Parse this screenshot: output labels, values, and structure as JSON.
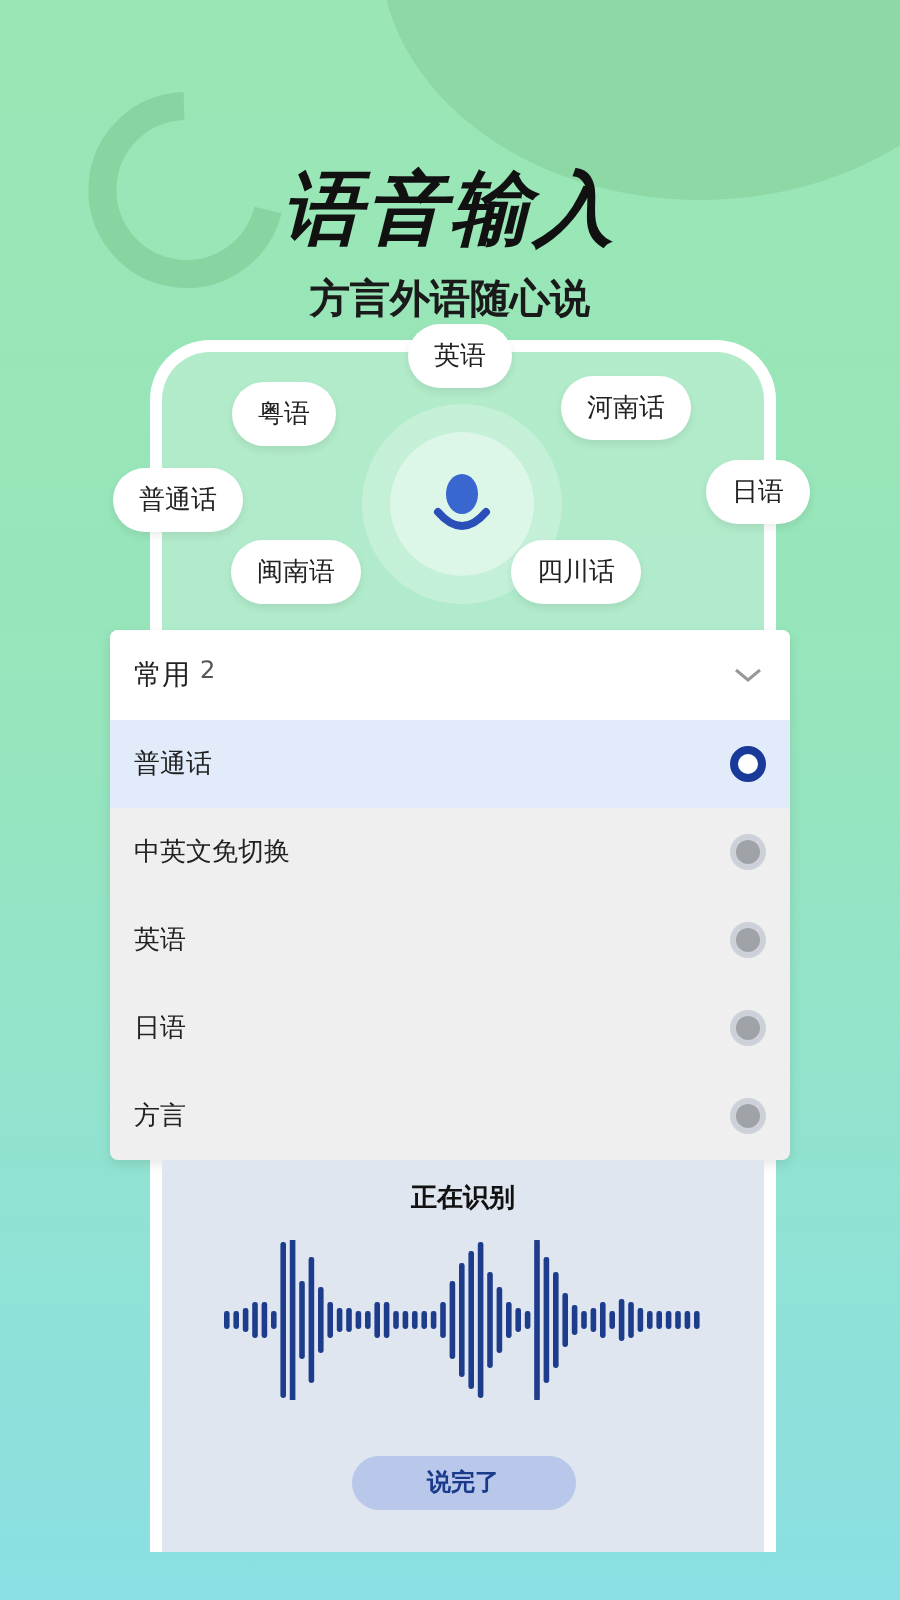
{
  "title": "语音输入",
  "subtitle": "方言外语随心说",
  "languages": [
    {
      "label": "英语"
    },
    {
      "label": "粤语"
    },
    {
      "label": "河南话"
    },
    {
      "label": "普通话"
    },
    {
      "label": "日语"
    },
    {
      "label": "闽南语"
    },
    {
      "label": "四川话"
    }
  ],
  "dropdown": {
    "label": "常用",
    "count": "2"
  },
  "options": [
    {
      "label": "普通话",
      "selected": true
    },
    {
      "label": "中英文免切换",
      "selected": false
    },
    {
      "label": "英语",
      "selected": false
    },
    {
      "label": "日语",
      "selected": false
    },
    {
      "label": "方言",
      "selected": false
    }
  ],
  "recognition": {
    "status": "正在识别",
    "button": "说完了"
  }
}
